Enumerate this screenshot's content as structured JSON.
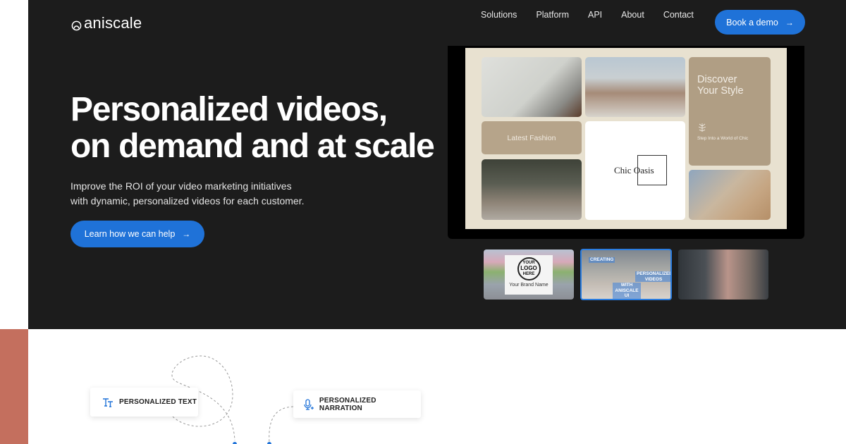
{
  "brand": {
    "name": "aniscale",
    "logo_icon": "aniscale-logo-icon"
  },
  "nav": {
    "items": [
      {
        "label": "Solutions"
      },
      {
        "label": "Platform"
      },
      {
        "label": "API"
      },
      {
        "label": "About"
      },
      {
        "label": "Contact"
      }
    ],
    "cta_label": "Book a demo",
    "cta_icon": "arrow-right-icon"
  },
  "hero": {
    "headline_line1": "Personalized videos,",
    "headline_line2": "on demand and at scale",
    "subtext_line1": "Improve the ROI of your video marketing initiatives",
    "subtext_line2": "with dynamic, personalized videos for each customer.",
    "cta_label": "Learn how we can help",
    "cta_icon": "arrow-right-icon"
  },
  "video_preview": {
    "latest_label": "Latest Fashion",
    "chic_label": "Chic Oasis",
    "discover_title_line1": "Discover",
    "discover_title_line2": "Your Style",
    "discover_subtitle": "Step Into a World of Chic",
    "discover_icon": "leaf-emblem-icon"
  },
  "thumbnails": [
    {
      "logo_text_1": "YOUR",
      "logo_text_2": "LOGO",
      "logo_text_3": "HERE",
      "brand_name": "Your Brand Name",
      "selected": false
    },
    {
      "cap_1": "CREATING",
      "cap_2": "PERSONALIZED VIDEOS",
      "cap_3": "WITH ANISCALE UI",
      "selected": true
    },
    {
      "selected": false
    }
  ],
  "features": [
    {
      "label": "PERSONALIZED TEXT",
      "icon": "text-size-icon"
    },
    {
      "label": "PERSONALIZED NARRATION",
      "icon": "microphone-plus-icon"
    }
  ],
  "colors": {
    "hero_bg": "#1c1c1c",
    "accent": "#1f72d8",
    "side_block": "#c46f5e",
    "slide_bg": "#e8e1d0",
    "tan_tile": "#b09e84"
  }
}
